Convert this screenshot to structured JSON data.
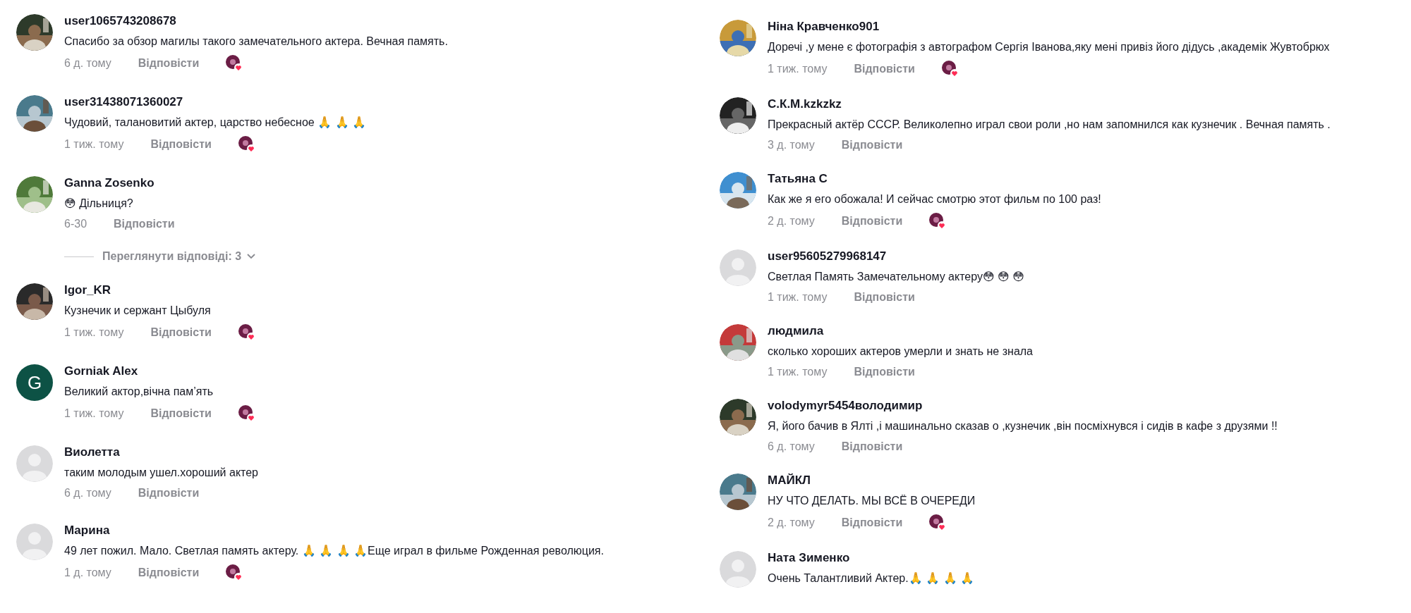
{
  "columns": [
    {
      "comments": [
        {
          "name": "user1065743208678",
          "text": "Спасибо за обзор магилы такого замечательного актера. Вечная память.",
          "time": "6 д. тому",
          "reply": "Відповісти",
          "creator_liked": true
        },
        {
          "name": "user31438071360027",
          "text": "Чудовий, талановитий актер, царство небесное 🙏 🙏 🙏",
          "time": "1 тиж. тому",
          "reply": "Відповісти",
          "creator_liked": true
        },
        {
          "name": "Ganna Zosenko",
          "text": "😳 Дільниця?",
          "time": "6-30",
          "reply": "Відповісти",
          "creator_liked": false,
          "view_replies": "Переглянути відповіді: 3"
        },
        {
          "name": "Igor_KR",
          "text": "Кузнечик и сержант Цыбуля",
          "time": "1 тиж. тому",
          "reply": "Відповісти",
          "creator_liked": true
        },
        {
          "kind": "initial",
          "initial": "G",
          "name": "Gorniak Alex",
          "text": "Великий актор,вічна пам’ять",
          "time": "1 тиж. тому",
          "reply": "Відповісти",
          "creator_liked": true
        },
        {
          "kind": "default",
          "name": "Виолетта",
          "text": "таким молодым ушел.хороший актер",
          "time": "6 д. тому",
          "reply": "Відповісти",
          "creator_liked": false
        },
        {
          "kind": "default",
          "name": "Марина",
          "text": "49 лет пожил. Мало. Светлая память актеру.  🙏 🙏 🙏 🙏Еще играл в фильме Рожденная революция.",
          "time": "1 д. тому",
          "reply": "Відповісти",
          "creator_liked": true
        }
      ]
    },
    {
      "comments": [
        {
          "name": "Ніна Кравченко901",
          "text": "Доречі ,у мене є фотографія з автографом Сергія Іванова,яку мені привіз його дідусь ,академік Жувтобрюх",
          "time": "1 тиж. тому",
          "reply": "Відповісти",
          "creator_liked": true
        },
        {
          "name": "С.К.М.kzkzkz",
          "text": "Прекрасный актёр СССР. Великолепно играл свои роли ,но нам запомнился как кузнечик . Вечная память .",
          "time": "3 д. тому",
          "reply": "Відповісти",
          "creator_liked": false
        },
        {
          "name": "Татьяна С",
          "text": "Как же я его обожала! И сейчас смотрю этот фильм по 100 раз!",
          "time": "2 д. тому",
          "reply": "Відповісти",
          "creator_liked": true
        },
        {
          "kind": "default",
          "name": "user95605279968147",
          "text": "Светлая Память Замечательному актеру😳 😳 😳",
          "time": "1 тиж. тому",
          "reply": "Відповісти",
          "creator_liked": false
        },
        {
          "name": "людмила",
          "text": "сколько хороших актеров умерли и знать не знала",
          "time": "1 тиж. тому",
          "reply": "Відповісти",
          "creator_liked": false
        },
        {
          "name": "volodymyr5454володимир",
          "text": "Я, його бачив в Ялті ,і машинально сказав о ,кузнечик ,він посміхнувся і сидів в кафе з друзями !!",
          "time": "6 д. тому",
          "reply": "Відповісти",
          "creator_liked": false
        },
        {
          "name": "МАЙКЛ",
          "text": "НУ ЧТО ДЕЛАТЬ. МЫ ВСЁ В ОЧЕРЕДИ",
          "time": "2 д. тому",
          "reply": "Відповісти",
          "creator_liked": true
        },
        {
          "kind": "default",
          "name": "Ната Зименко",
          "text": "Очень Талантливий Актер.🙏 🙏 🙏 🙏"
        }
      ]
    }
  ]
}
